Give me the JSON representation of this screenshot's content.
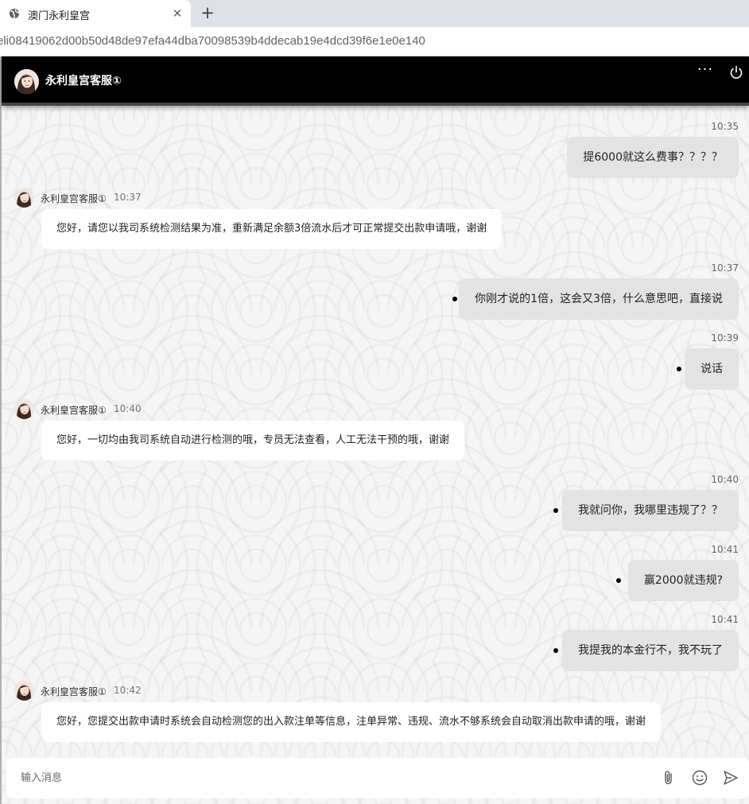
{
  "browser": {
    "tab_title": "澳门永利皇宫",
    "url": "eli08419062d00b50d48de97efa44dba70098539b4ddecab19e4dcd39f6e1e0e140"
  },
  "header": {
    "title": "永利皇宫客服①"
  },
  "messages": [
    {
      "dir": "out",
      "time": "10:35",
      "text": "提6000就这么费事？？？？"
    },
    {
      "dir": "in",
      "sender": "永利皇宫客服①",
      "time": "10:37",
      "text": "您好，请您以我司系统检测结果为准，重新满足余额3倍流水后才可正常提交出款申请哦，谢谢"
    },
    {
      "dir": "out",
      "time": "10:37",
      "text": "你刚才说的1倍，这会又3倍，什么意思吧，直接说"
    },
    {
      "dir": "out",
      "time": "10:39",
      "text": "说话"
    },
    {
      "dir": "in",
      "sender": "永利皇宫客服①",
      "time": "10:40",
      "text": "您好，一切均由我司系统自动进行检测的哦，专员无法查看，人工无法干预的哦，谢谢"
    },
    {
      "dir": "out",
      "time": "10:40",
      "text": "我就问你，我哪里违规了？？"
    },
    {
      "dir": "out",
      "time": "10:41",
      "text": "赢2000就违规?"
    },
    {
      "dir": "out",
      "time": "10:41",
      "text": "我提我的本金行不，我不玩了"
    },
    {
      "dir": "in",
      "sender": "永利皇宫客服①",
      "time": "10:42",
      "text": "您好，您提交出款申请时系统会自动检测您的出入款注单等信息，注单异常、违规、流水不够系统会自动取消出款申请的哦，谢谢"
    }
  ],
  "input": {
    "placeholder": "输入消息"
  },
  "icons": {
    "tab": "globe-icon",
    "more": "more-icon",
    "power": "power-icon",
    "attach": "paperclip-icon",
    "emoji": "emoji-icon",
    "send": "send-icon"
  }
}
